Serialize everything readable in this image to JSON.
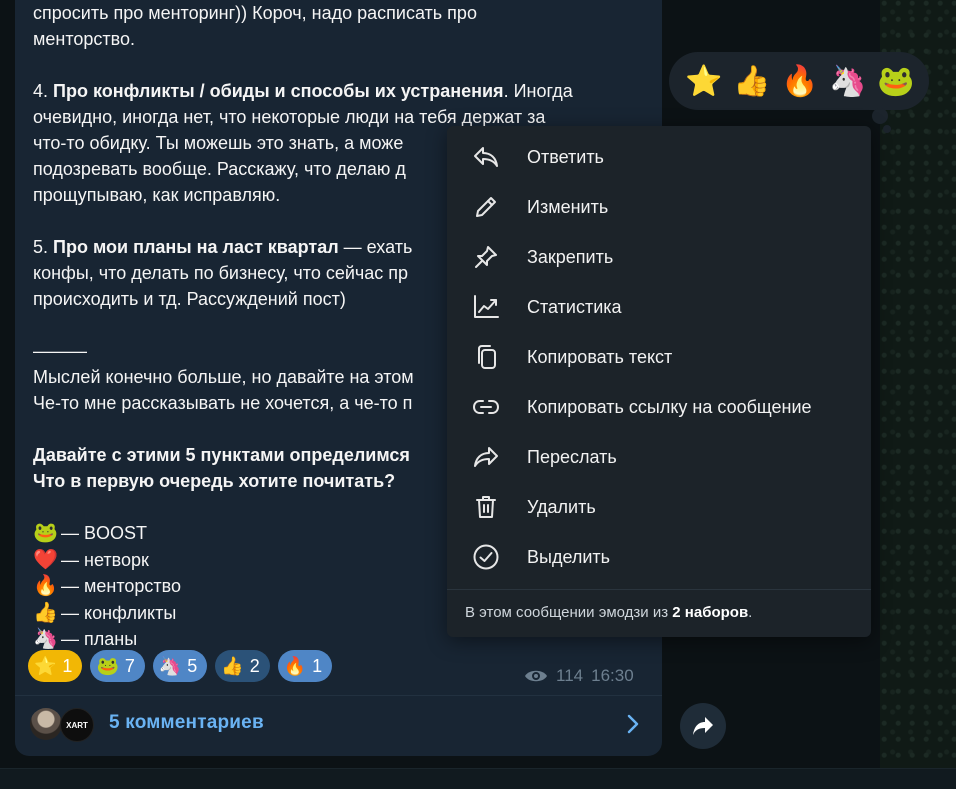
{
  "message": {
    "lines_top": [
      "спросить про менторинг)) Короч, надо расписать про",
      "менторство."
    ],
    "p4_bold": "Про конфликты / обиды и способы их устранения",
    "p4_prefix": "4. ",
    "p4_after": ". Иногда",
    "p4_lines": [
      "очевидно, иногда нет, что некоторые люди на тебя держат за",
      "что-то обидку. Ты можешь это знать, а може",
      "подозревать вообще. Расскажу, что делаю д",
      "прощупываю, как исправляю."
    ],
    "p5_prefix": "5. ",
    "p5_bold": "Про мои планы на ласт квартал",
    "p5_after": " — ехать",
    "p5_lines": [
      "конфы, что делать по бизнесу, что сейчас пр",
      "происходить и тд. Рассуждений пост)"
    ],
    "dashes": "———",
    "p6_lines": [
      "Мыслей конечно больше, но давайте на этом",
      "Че-то мне рассказывать не хочется, а че-то п"
    ],
    "bold_lines": [
      "Давайте с этими 5 пунктами определимся",
      "Что в первую очередь хотите почитать?"
    ],
    "vote_options": [
      {
        "emoji": "🐸",
        "label": "— BOOST"
      },
      {
        "emoji": "❤️",
        "label": "— нетворк"
      },
      {
        "emoji": "🔥",
        "label": "— менторство"
      },
      {
        "emoji": "👍",
        "label": "— конфликты"
      },
      {
        "emoji": "🦄",
        "label": "— планы"
      }
    ]
  },
  "reactions": [
    {
      "emoji": "⭐",
      "count": "1"
    },
    {
      "emoji": "🐸",
      "count": "7"
    },
    {
      "emoji": "🦄",
      "count": "5"
    },
    {
      "emoji": "👍",
      "count": "2"
    },
    {
      "emoji": "🔥",
      "count": "1"
    }
  ],
  "meta": {
    "views": "114",
    "time": "16:30"
  },
  "comments": {
    "label": "5 комментариев",
    "avatar2_text": "XART"
  },
  "picker": [
    "⭐",
    "👍",
    "🔥",
    "🦄",
    "🐸"
  ],
  "menu": {
    "items": [
      {
        "label": "Ответить",
        "icon": "reply-icon"
      },
      {
        "label": "Изменить",
        "icon": "pencil-icon"
      },
      {
        "label": "Закрепить",
        "icon": "pin-icon"
      },
      {
        "label": "Статистика",
        "icon": "stats-icon"
      },
      {
        "label": "Копировать текст",
        "icon": "copy-icon"
      },
      {
        "label": "Копировать ссылку на сообщение",
        "icon": "link-icon"
      },
      {
        "label": "Переслать",
        "icon": "forward-icon"
      },
      {
        "label": "Удалить",
        "icon": "trash-icon"
      },
      {
        "label": "Выделить",
        "icon": "check-circle-icon"
      }
    ],
    "footer_prefix": "В этом сообщении эмодзи из ",
    "footer_bold": "2 наборов",
    "footer_suffix": "."
  },
  "colors": {
    "bubble": "#182533",
    "accent": "#6ab3f3",
    "star_reaction": "#f2b705",
    "reaction": "#2b5278"
  }
}
